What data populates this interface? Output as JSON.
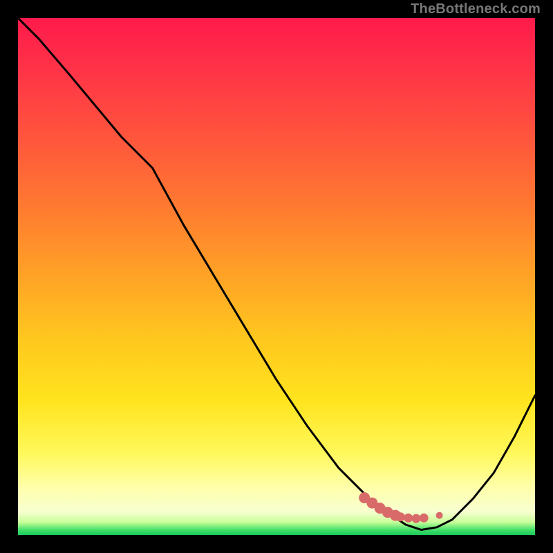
{
  "watermark": "TheBottleneck.com",
  "chart_data": {
    "type": "line",
    "title": "",
    "xlabel": "",
    "ylabel": "",
    "xlim": [
      0,
      100
    ],
    "ylim": [
      0,
      100
    ],
    "grid": false,
    "series": [
      {
        "name": "curve",
        "x": [
          0,
          4,
          10,
          15,
          20,
          26,
          32,
          38,
          44,
          50,
          56,
          62,
          68,
          72,
          75,
          78,
          81,
          84,
          88,
          92,
          96,
          100
        ],
        "y": [
          100,
          96,
          89,
          83,
          77,
          71,
          60,
          50,
          40,
          30,
          21,
          13,
          7,
          4,
          2,
          1,
          1.5,
          3,
          7,
          12,
          19,
          27
        ]
      }
    ],
    "markers": {
      "x": [
        67,
        68.5,
        70,
        71.5,
        73,
        74,
        75.5,
        77,
        78.5,
        81.5
      ],
      "y": [
        7.2,
        6.2,
        5.2,
        4.4,
        3.8,
        3.5,
        3.3,
        3.2,
        3.3,
        3.8
      ]
    },
    "gradient_stops": [
      {
        "offset": 0.0,
        "color": "#ff1a4b"
      },
      {
        "offset": 0.12,
        "color": "#ff3846"
      },
      {
        "offset": 0.25,
        "color": "#ff5a3b"
      },
      {
        "offset": 0.38,
        "color": "#ff7e2f"
      },
      {
        "offset": 0.5,
        "color": "#ffa326"
      },
      {
        "offset": 0.62,
        "color": "#ffc71e"
      },
      {
        "offset": 0.74,
        "color": "#ffe41e"
      },
      {
        "offset": 0.84,
        "color": "#fff85a"
      },
      {
        "offset": 0.91,
        "color": "#ffffac"
      },
      {
        "offset": 0.955,
        "color": "#f7ffd0"
      },
      {
        "offset": 0.975,
        "color": "#c9ff9a"
      },
      {
        "offset": 0.99,
        "color": "#43e06a"
      },
      {
        "offset": 1.0,
        "color": "#18c85a"
      }
    ],
    "curve_color": "#000000",
    "marker_color": "#d96a6a"
  }
}
